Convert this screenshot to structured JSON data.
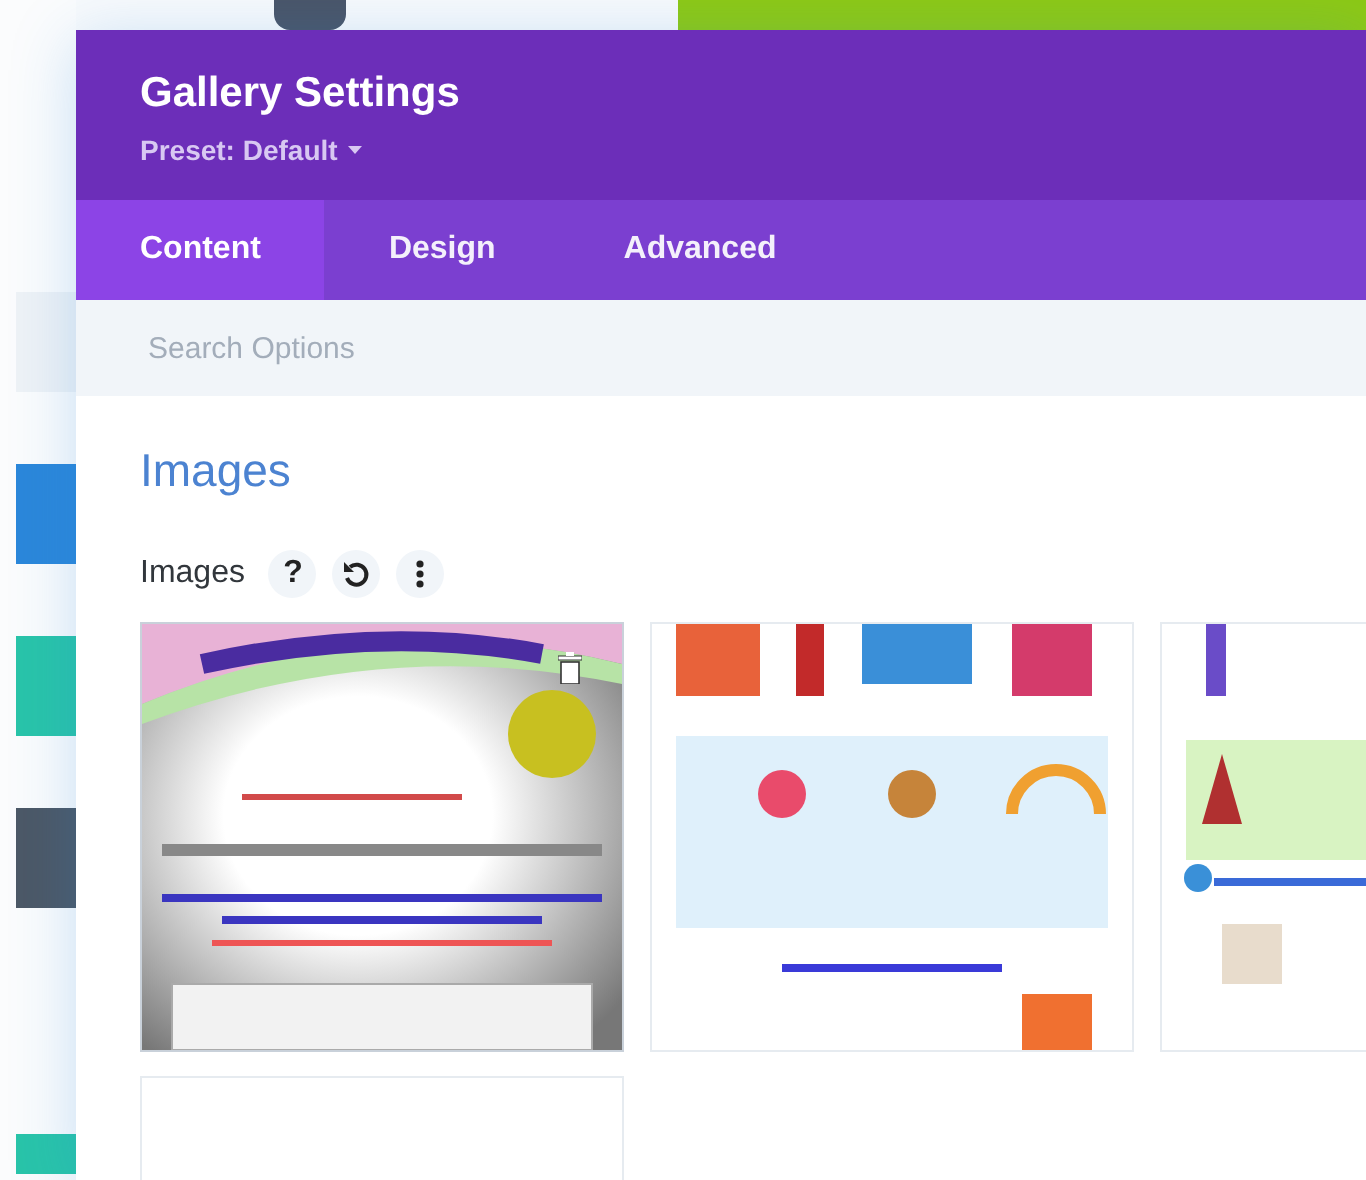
{
  "modal": {
    "title": "Gallery Settings",
    "preset": "Preset: Default"
  },
  "tabs": [
    {
      "label": "Content",
      "selected": true
    },
    {
      "label": "Design",
      "selected": false
    },
    {
      "label": "Advanced",
      "selected": false
    }
  ],
  "search": {
    "placeholder": "Search Options"
  },
  "section": {
    "title": "Images"
  },
  "field": {
    "label": "Images",
    "help": "?"
  },
  "gallery": [
    {
      "kind": "picture",
      "hovered": true
    },
    {
      "kind": "picture",
      "hovered": false
    },
    {
      "kind": "picture",
      "hovered": false
    },
    {
      "kind": "empty",
      "hovered": false
    }
  ]
}
